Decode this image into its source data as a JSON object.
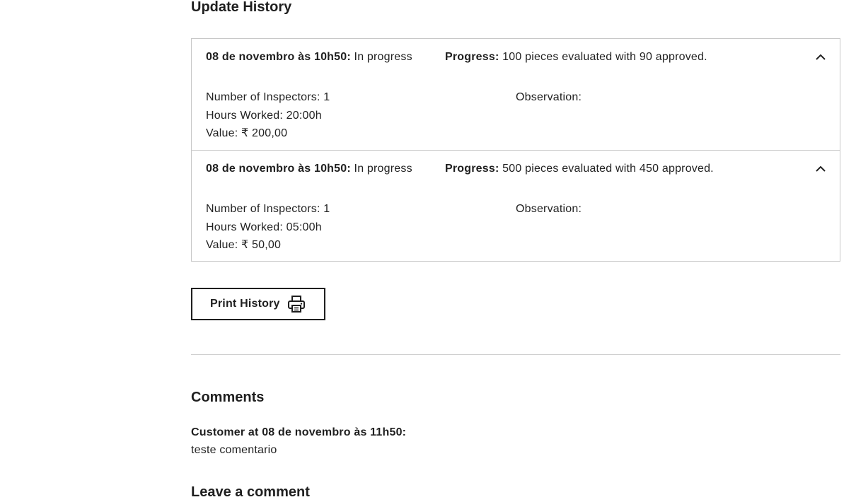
{
  "update_history": {
    "title": "Update History",
    "entries": [
      {
        "date": "08 de novembro às 10h50:",
        "status": "In progress",
        "progress_label": "Progress:",
        "progress_text": "100 pieces evaluated with 90 approved.",
        "inspectors": "Number of Inspectors: 1",
        "hours": "Hours Worked: 20:00h",
        "value": "Value: ₹ 200,00",
        "observation": "Observation:"
      },
      {
        "date": "08 de novembro às 10h50:",
        "status": "In progress",
        "progress_label": "Progress:",
        "progress_text": "500 pieces evaluated with 450 approved.",
        "inspectors": "Number of Inspectors: 1",
        "hours": "Hours Worked: 05:00h",
        "value": "Value: ₹ 50,00",
        "observation": "Observation:"
      }
    ],
    "print_button_label": "Print History",
    "print_icon": "printer-icon",
    "expand_icon": "chevron-up-icon"
  },
  "comments": {
    "title": "Comments",
    "items": [
      {
        "author": "Customer at 08 de novembro às 11h50:",
        "text": "teste comentario"
      }
    ]
  },
  "leave_comment": {
    "title": "Leave a comment"
  }
}
